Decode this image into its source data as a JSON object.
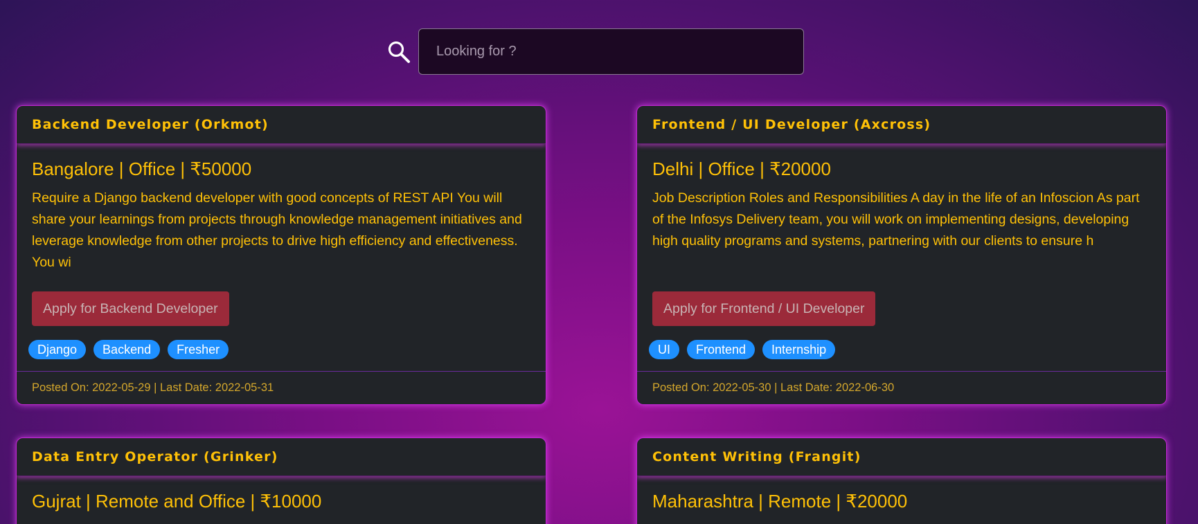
{
  "search": {
    "placeholder": "Looking for ?",
    "icon": "search-icon"
  },
  "jobs": [
    {
      "title": "Backend Developer (Orkmot)",
      "subtitle": "Bangalore | Office | ₹50000",
      "description": "Require a Django backend developer with good concepts of REST API You will share your learnings from projects through knowledge management initiatives and leverage knowledge from other projects to drive high efficiency and effectiveness. You wi",
      "apply_label": "Apply for Backend Developer",
      "tags": [
        "Django",
        "Backend",
        "Fresher"
      ],
      "footer": "Posted On: 2022-05-29 | Last Date: 2022-05-31"
    },
    {
      "title": "Frontend / UI Developer (Axcross)",
      "subtitle": "Delhi | Office | ₹20000",
      "description": "Job Description Roles and Responsibilities A day in the life of an Infoscion As part of the Infosys Delivery team, you will work on implementing designs, developing high quality programs and systems, partnering with our clients to ensure h",
      "apply_label": "Apply for Frontend / UI Developer",
      "tags": [
        "UI",
        "Frontend",
        "Internship"
      ],
      "footer": "Posted On: 2022-05-30 | Last Date: 2022-06-30"
    },
    {
      "title": "Data Entry Operator (Grinker)",
      "subtitle": "Gujrat | Remote and Office | ₹10000"
    },
    {
      "title": "Content Writing (Frangit)",
      "subtitle": "Maharashtra | Remote | ₹20000"
    }
  ],
  "colors": {
    "accent": "#ffc107",
    "card_bg": "#212428",
    "tag_bg": "#1e90ff",
    "button_bg": "#9b2a3a",
    "glow": "#c026d3"
  }
}
